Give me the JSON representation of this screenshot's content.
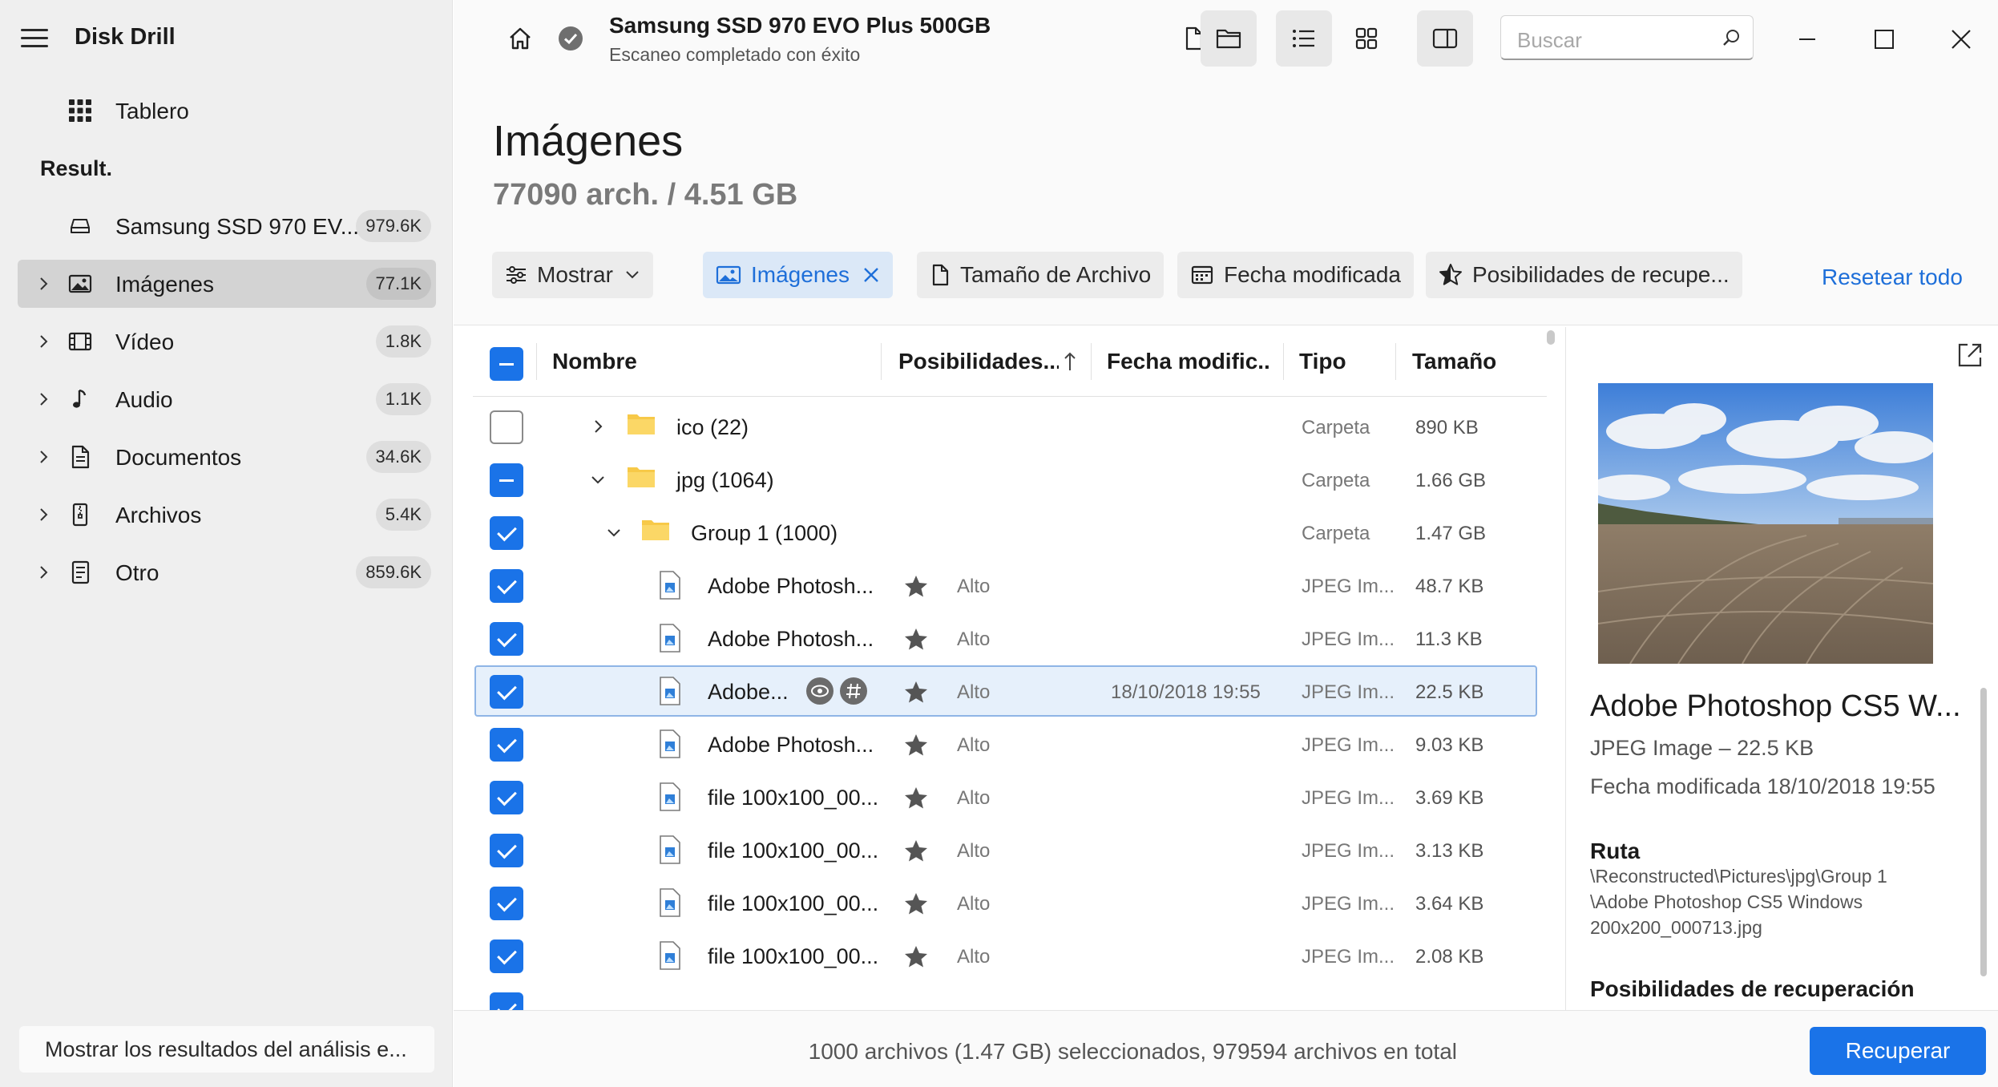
{
  "app": {
    "title": "Disk Drill"
  },
  "sidebar": {
    "dashboard_label": "Tablero",
    "section_label": "Result.",
    "device": {
      "label": "Samsung SSD 970 EV...",
      "count": "979.6K"
    },
    "items": [
      {
        "label": "Imágenes",
        "count": "77.1K",
        "icon": "image-icon",
        "active": true
      },
      {
        "label": "Vídeo",
        "count": "1.8K",
        "icon": "video-icon"
      },
      {
        "label": "Audio",
        "count": "1.1K",
        "icon": "music-note-icon"
      },
      {
        "label": "Documentos",
        "count": "34.6K",
        "icon": "document-icon"
      },
      {
        "label": "Archivos",
        "count": "5.4K",
        "icon": "archive-icon"
      },
      {
        "label": "Otro",
        "count": "859.6K",
        "icon": "other-file-icon"
      }
    ],
    "bottom_button": "Mostrar los resultados del análisis e..."
  },
  "topbar": {
    "device_title": "Samsung SSD 970 EVO Plus 500GB",
    "device_status": "Escaneo completado con éxito",
    "search_placeholder": "Buscar"
  },
  "header": {
    "title": "Imágenes",
    "subtitle": "77090 arch. / 4.51 GB",
    "filters": {
      "show": "Mostrar",
      "images": "Imágenes",
      "size": "Tamaño de Archivo",
      "date": "Fecha modificada",
      "chances": "Posibilidades de recupe..."
    },
    "reset": "Resetear todo"
  },
  "table": {
    "columns": {
      "name": "Nombre",
      "chances": "Posibilidades...",
      "date": "Fecha modific...",
      "type": "Tipo",
      "size": "Tamaño"
    },
    "rows": [
      {
        "name": "ico (22)",
        "type": "Carpeta",
        "size": "890 KB",
        "chances": "",
        "date": ""
      },
      {
        "name": "jpg (1064)",
        "type": "Carpeta",
        "size": "1.66 GB",
        "chances": "",
        "date": ""
      },
      {
        "name": "Group 1 (1000)",
        "type": "Carpeta",
        "size": "1.47 GB",
        "chances": "",
        "date": ""
      },
      {
        "name": "Adobe Photosh...",
        "type": "JPEG Im...",
        "size": "48.7 KB",
        "chances": "Alto",
        "date": ""
      },
      {
        "name": "Adobe Photosh...",
        "type": "JPEG Im...",
        "size": "11.3 KB",
        "chances": "Alto",
        "date": ""
      },
      {
        "name": "Adobe...",
        "type": "JPEG Im...",
        "size": "22.5 KB",
        "chances": "Alto",
        "date": "18/10/2018 19:55"
      },
      {
        "name": "Adobe Photosh...",
        "type": "JPEG Im...",
        "size": "9.03 KB",
        "chances": "Alto",
        "date": ""
      },
      {
        "name": "file 100x100_00...",
        "type": "JPEG Im...",
        "size": "3.69 KB",
        "chances": "Alto",
        "date": ""
      },
      {
        "name": "file 100x100_00...",
        "type": "JPEG Im...",
        "size": "3.13 KB",
        "chances": "Alto",
        "date": ""
      },
      {
        "name": "file 100x100_00...",
        "type": "JPEG Im...",
        "size": "3.64 KB",
        "chances": "Alto",
        "date": ""
      },
      {
        "name": "file 100x100_00...",
        "type": "JPEG Im...",
        "size": "2.08 KB",
        "chances": "Alto",
        "date": ""
      }
    ]
  },
  "preview": {
    "title": "Adobe Photoshop CS5 W...",
    "type_size": "JPEG Image – 22.5 KB",
    "modified": "Fecha modificada 18/10/2018 19:55",
    "path_label": "Ruta",
    "path_line1": "\\Reconstructed\\Pictures\\jpg\\Group 1",
    "path_line2": "\\Adobe Photoshop CS5 Windows",
    "path_line3": "200x200_000713.jpg",
    "chances_label": "Posibilidades de recuperación"
  },
  "footer": {
    "status": "1000 archivos (1.47 GB) seleccionados, 979594 archivos en total",
    "recover": "Recuperar"
  },
  "colors": {
    "accent": "#1a73e8",
    "selected_row": "#e6f0fb",
    "folder": "#f7c948"
  }
}
